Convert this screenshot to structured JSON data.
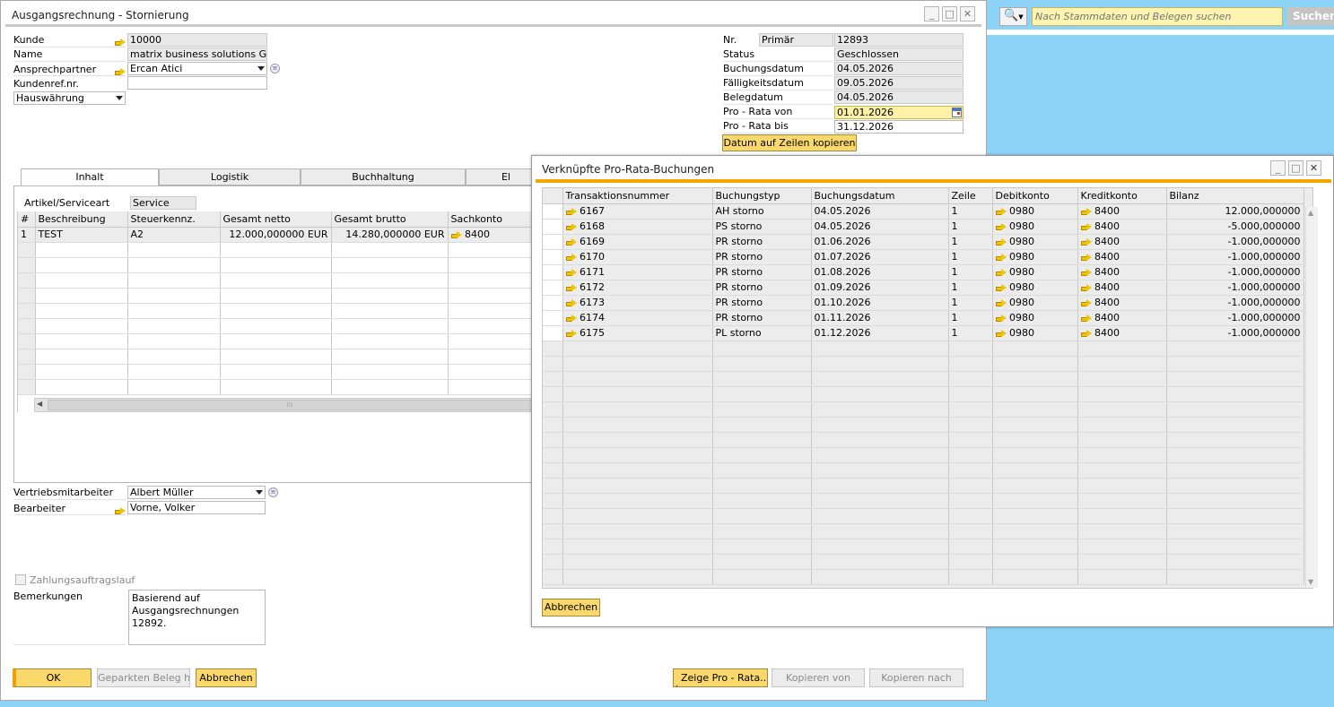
{
  "main_window": {
    "title": "Ausgangsrechnung - Stornierung"
  },
  "search": {
    "placeholder": "Nach Stammdaten und Belegen suchen",
    "button_label": "Suchen"
  },
  "header": {
    "kunde_label": "Kunde",
    "kunde_value": "10000",
    "name_label": "Name",
    "name_value": "matrix business solutions GmbH",
    "ansprech_label": "Ansprechpartner",
    "ansprech_value": "Ercan Atici",
    "kundenref_label": "Kundenref.nr.",
    "kundenref_value": "",
    "waehrung_value": "Hauswährung",
    "nr_label": "Nr.",
    "nr_series": "Primär",
    "nr_value": "12893",
    "status_label": "Status",
    "status_value": "Geschlossen",
    "buchungsdatum_label": "Buchungsdatum",
    "buchungsdatum_value": "04.05.2026",
    "faelligkeit_label": "Fälligkeitsdatum",
    "faelligkeit_value": "09.05.2026",
    "belegdatum_label": "Belegdatum",
    "belegdatum_value": "04.05.2026",
    "prorata_von_label": "Pro - Rata von",
    "prorata_von_value": "01.01.2026",
    "prorata_bis_label": "Pro - Rata bis",
    "prorata_bis_value": "31.12.2026",
    "copy_dates_button": "Datum auf Zeilen kopieren"
  },
  "tabs": [
    "Inhalt",
    "Logistik",
    "Buchhaltung",
    "El"
  ],
  "content": {
    "artikel_label": "Artikel/Serviceart",
    "artikel_value": "Service",
    "columns": [
      "#",
      "Beschreibung",
      "Steuerkennz.",
      "Gesamt netto",
      "Gesamt brutto",
      "Sachkonto"
    ],
    "rows": [
      {
        "num": "1",
        "beschreibung": "TEST",
        "steuer": "A2",
        "netto": "12.000,000000 EUR",
        "brutto": "14.280,000000 EUR",
        "sachkonto": "8400"
      }
    ]
  },
  "footer": {
    "vertrieb_label": "Vertriebsmitarbeiter",
    "vertrieb_value": "Albert Müller",
    "bearbeiter_label": "Bearbeiter",
    "bearbeiter_value": "Vorne, Volker",
    "zahlung_label": "Zahlungsauftragslauf",
    "bemerkungen_label": "Bemerkungen",
    "bemerkungen_value": "Basierend auf Ausgangsrechnungen 12892.",
    "ok_button": "OK",
    "parked_button": "Geparkten Beleg hi...",
    "cancel_button": "Abbrechen",
    "zeige_button": "Zeige Pro - Rata...",
    "kopieren_von_button": "Kopieren von",
    "kopieren_nach_button": "Kopieren nach"
  },
  "dialog": {
    "title": "Verknüpfte Pro-Rata-Buchungen",
    "columns": [
      "Transaktionsnummer",
      "Buchungstyp",
      "Buchungsdatum",
      "Zeile",
      "Debitkonto",
      "Kreditkonto",
      "Bilanz"
    ],
    "rows": [
      {
        "trans": "6167",
        "typ": "AH storno",
        "datum": "04.05.2026",
        "zeile": "1",
        "debit": "0980",
        "kredit": "8400",
        "bilanz": "12.000,000000"
      },
      {
        "trans": "6168",
        "typ": "PS storno",
        "datum": "04.05.2026",
        "zeile": "1",
        "debit": "0980",
        "kredit": "8400",
        "bilanz": "-5.000,000000"
      },
      {
        "trans": "6169",
        "typ": "PR storno",
        "datum": "01.06.2026",
        "zeile": "1",
        "debit": "0980",
        "kredit": "8400",
        "bilanz": "-1.000,000000"
      },
      {
        "trans": "6170",
        "typ": "PR storno",
        "datum": "01.07.2026",
        "zeile": "1",
        "debit": "0980",
        "kredit": "8400",
        "bilanz": "-1.000,000000"
      },
      {
        "trans": "6171",
        "typ": "PR storno",
        "datum": "01.08.2026",
        "zeile": "1",
        "debit": "0980",
        "kredit": "8400",
        "bilanz": "-1.000,000000"
      },
      {
        "trans": "6172",
        "typ": "PR storno",
        "datum": "01.09.2026",
        "zeile": "1",
        "debit": "0980",
        "kredit": "8400",
        "bilanz": "-1.000,000000"
      },
      {
        "trans": "6173",
        "typ": "PR storno",
        "datum": "01.10.2026",
        "zeile": "1",
        "debit": "0980",
        "kredit": "8400",
        "bilanz": "-1.000,000000"
      },
      {
        "trans": "6174",
        "typ": "PR storno",
        "datum": "01.11.2026",
        "zeile": "1",
        "debit": "0980",
        "kredit": "8400",
        "bilanz": "-1.000,000000"
      },
      {
        "trans": "6175",
        "typ": "PL storno",
        "datum": "01.12.2026",
        "zeile": "1",
        "debit": "0980",
        "kredit": "8400",
        "bilanz": "-1.000,000000"
      }
    ],
    "cancel_button": "Abbrechen"
  }
}
